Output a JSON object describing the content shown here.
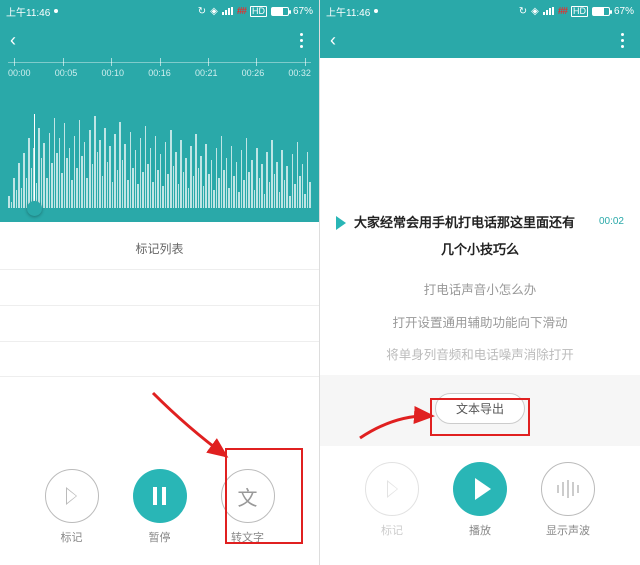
{
  "status": {
    "time": "上午11:46",
    "hd": "HD",
    "battery": "67%",
    "net": "4G"
  },
  "left": {
    "timeline": [
      "00:00",
      "00:05",
      "00:10",
      "00:16",
      "00:21",
      "00:26",
      "00:32"
    ],
    "marklist_title": "标记列表",
    "controls": {
      "mark": "标记",
      "pause": "暂停",
      "totext": "转文字"
    },
    "totext_glyph": "文"
  },
  "right": {
    "transcript": {
      "line1": "大家经常会用手机打电话那这里面还有",
      "timestamp": "00:02",
      "line2": "几个小技巧么",
      "gray1": "打电话声音小怎么办",
      "gray2": "打开设置通用辅助功能向下滑动",
      "fade": "将单身列音频和电话噪声消除打开"
    },
    "export_label": "文本导出",
    "controls": {
      "mark": "标记",
      "play": "播放",
      "wave": "显示声波"
    }
  }
}
